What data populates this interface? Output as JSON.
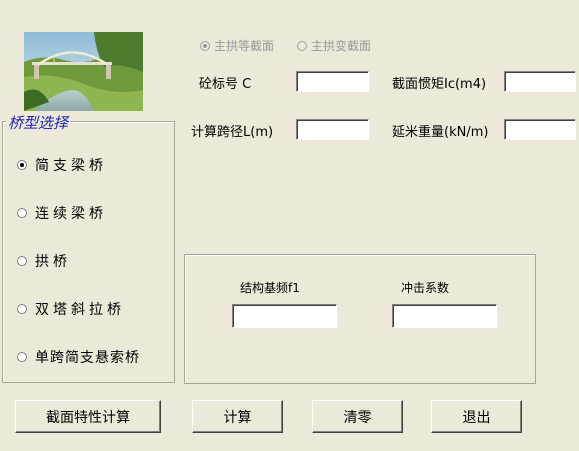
{
  "arch_section": {
    "options": [
      {
        "label": "主拱等截面",
        "checked": true
      },
      {
        "label": "主拱变截面",
        "checked": false
      }
    ]
  },
  "fields": {
    "concrete_grade": {
      "label": "砼标号 C",
      "value": ""
    },
    "inertia": {
      "label": "截面惯矩Ic(m4)",
      "value": ""
    },
    "span": {
      "label": "计算跨径L(m)",
      "value": ""
    },
    "weight": {
      "label": "延米重量(kN/m)",
      "value": ""
    }
  },
  "bridge_type": {
    "legend": "桥型选择",
    "options": [
      {
        "label": "简支梁桥",
        "checked": true
      },
      {
        "label": "连续梁桥",
        "checked": false
      },
      {
        "label": "拱桥",
        "checked": false
      },
      {
        "label": "双塔斜拉桥",
        "checked": false
      },
      {
        "label": "单跨简支悬索桥",
        "checked": false
      }
    ]
  },
  "results": {
    "frequency": {
      "label": "结构基频f1",
      "value": ""
    },
    "impact": {
      "label": "冲击系数",
      "value": ""
    }
  },
  "buttons": {
    "section_calc": "截面特性计算",
    "calc": "计算",
    "clear": "清零",
    "exit": "退出"
  }
}
